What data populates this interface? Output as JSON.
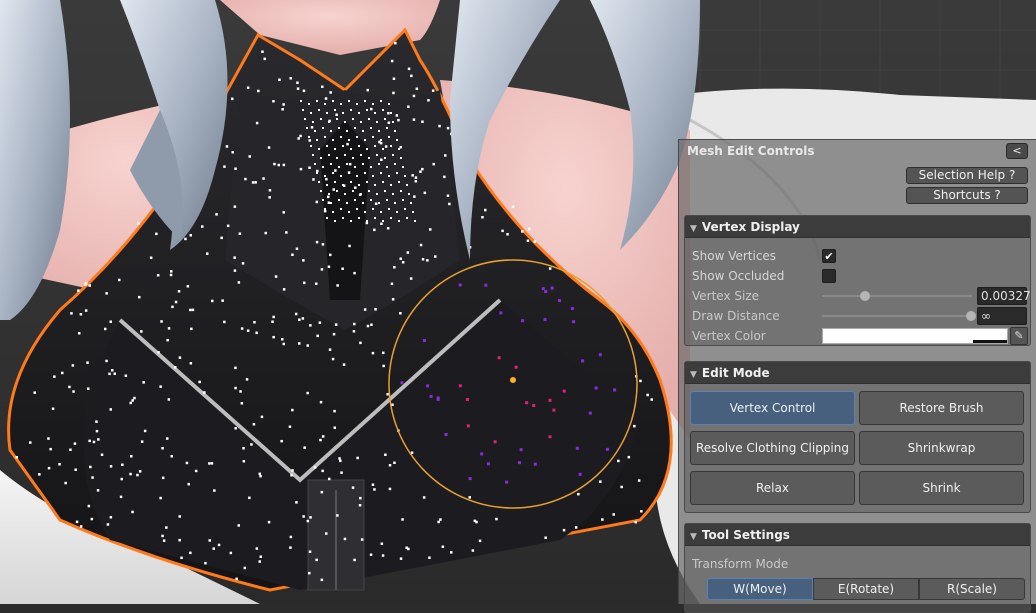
{
  "panel": {
    "title": "Mesh Edit Controls",
    "collapse_label": "<",
    "selection_help_label": "Selection Help ?",
    "shortcuts_label": "Shortcuts ?"
  },
  "vertex_display": {
    "header": "Vertex Display",
    "show_vertices_label": "Show Vertices",
    "show_vertices_checked": true,
    "show_occluded_label": "Show Occluded",
    "show_occluded_checked": false,
    "vertex_size_label": "Vertex Size",
    "vertex_size_value": "0.00327",
    "draw_distance_label": "Draw Distance",
    "draw_distance_value": "∞",
    "vertex_color_label": "Vertex Color",
    "vertex_color": "#ffffff"
  },
  "edit_mode": {
    "header": "Edit Mode",
    "buttons": [
      "Vertex Control",
      "Restore Brush",
      "Resolve Clothing Clipping",
      "Shrinkwrap",
      "Relax",
      "Shrink"
    ],
    "active": "Vertex Control"
  },
  "tool_settings": {
    "header": "Tool Settings",
    "transform_mode_label": "Transform Mode",
    "transform_modes": [
      "W(Move)",
      "E(Rotate)",
      "R(Scale)"
    ],
    "active_mode": "W(Move)"
  },
  "icons": {
    "section_toggle": "triangle-down-icon",
    "checkmark": "checkmark-icon",
    "eyedropper": "eyedropper-icon"
  },
  "colors": {
    "accent": "#46607e",
    "selection_outline": "#ff7a1a",
    "brush_circle": "#e8a030",
    "selected_vertex": "#8a2be2",
    "unselected_vertex": "#ffffff"
  }
}
